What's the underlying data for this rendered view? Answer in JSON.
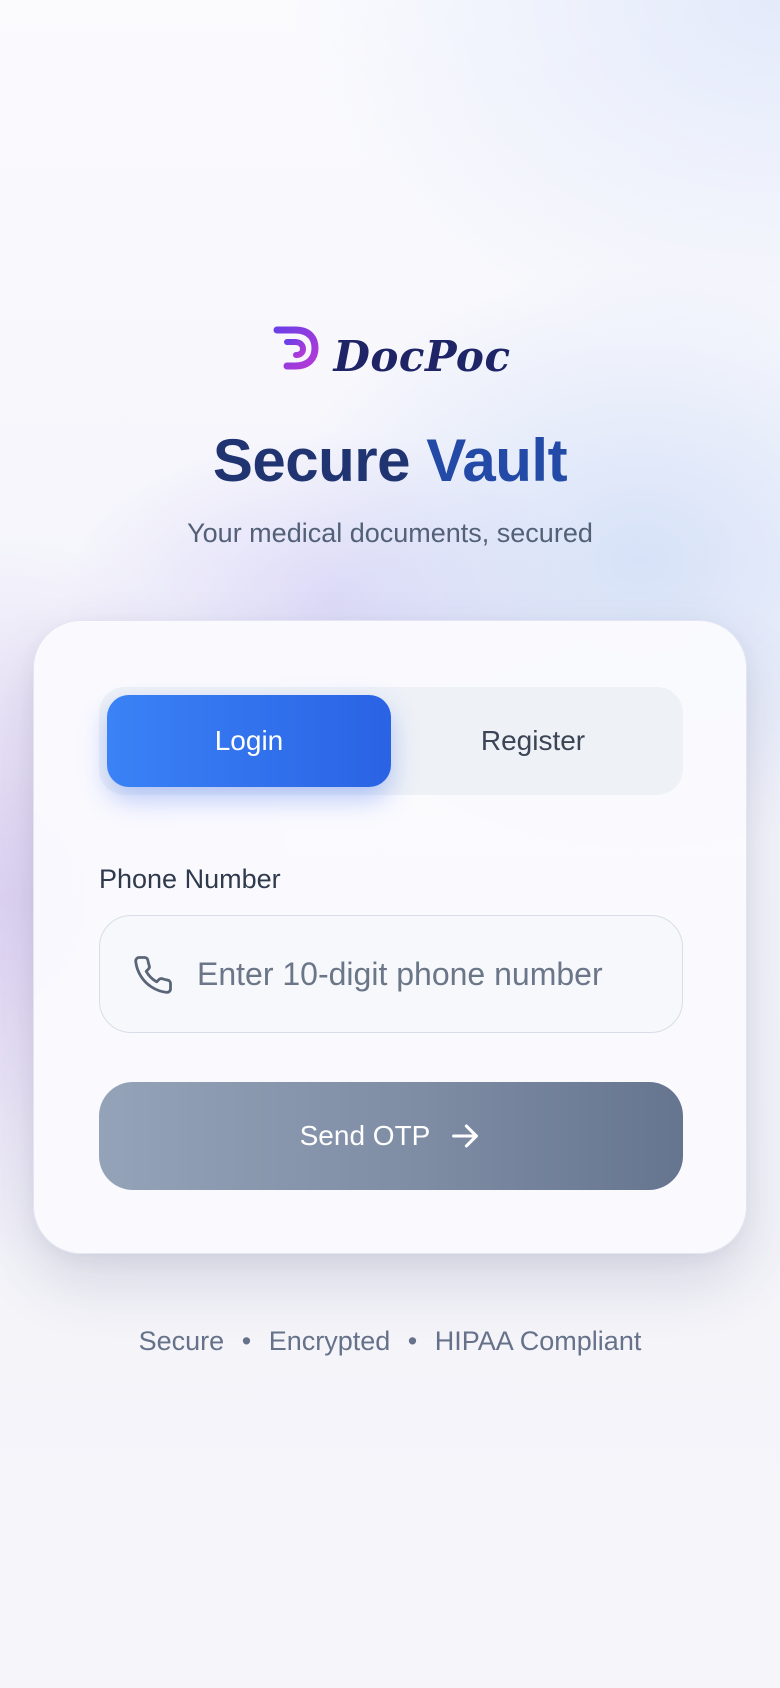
{
  "brand": {
    "name": "DocPoc",
    "logo_icon": "docpoc-p-logo"
  },
  "header": {
    "title_part1": "Secure",
    "title_part2": "Vault",
    "subtitle": "Your medical documents, secured"
  },
  "auth_card": {
    "tabs": [
      {
        "label": "Login",
        "active": true
      },
      {
        "label": "Register",
        "active": false
      }
    ],
    "phone_field": {
      "label": "Phone Number",
      "icon": "phone-icon",
      "value": "",
      "placeholder": "Enter 10-digit phone number"
    },
    "submit_button": {
      "label": "Send OTP",
      "icon": "arrow-right-icon"
    }
  },
  "footer": {
    "items": [
      "Secure",
      "Encrypted",
      "HIPAA Compliant"
    ],
    "separator": "•"
  },
  "colors": {
    "accent_blue": "#3a82f6",
    "title_dark": "#1f3470",
    "title_blue": "#224aa6",
    "brand_purple": "#8b3fe0",
    "button_gray": "#7e8ca4"
  }
}
